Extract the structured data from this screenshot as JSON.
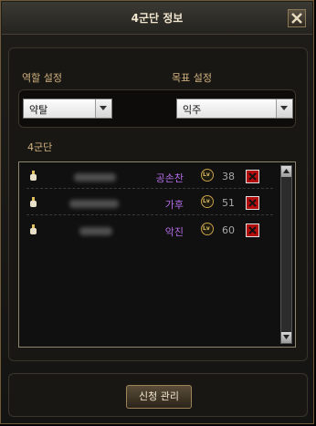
{
  "window": {
    "title": "4군단 정보"
  },
  "roles": {
    "role_label": "역할 설정",
    "role_value": "약탈",
    "target_label": "목표 설정",
    "target_value": "익주"
  },
  "corps": {
    "section_label": "4군단",
    "members": [
      {
        "name": "공손찬",
        "level": "38"
      },
      {
        "name": "가후",
        "level": "51"
      },
      {
        "name": "악진",
        "level": "60"
      }
    ],
    "level_icon_text": "Lv"
  },
  "footer": {
    "manage_button": "신청 관리"
  },
  "icons": {
    "close": "close-icon",
    "dropdown": "chevron-down-icon",
    "member_marker": "pin-icon",
    "level": "level-badge-icon",
    "remove": "remove-icon"
  },
  "colors": {
    "accent_gold": "#d2b27f",
    "member_name": "#b46ce6",
    "remove_red": "#b40d0d"
  }
}
